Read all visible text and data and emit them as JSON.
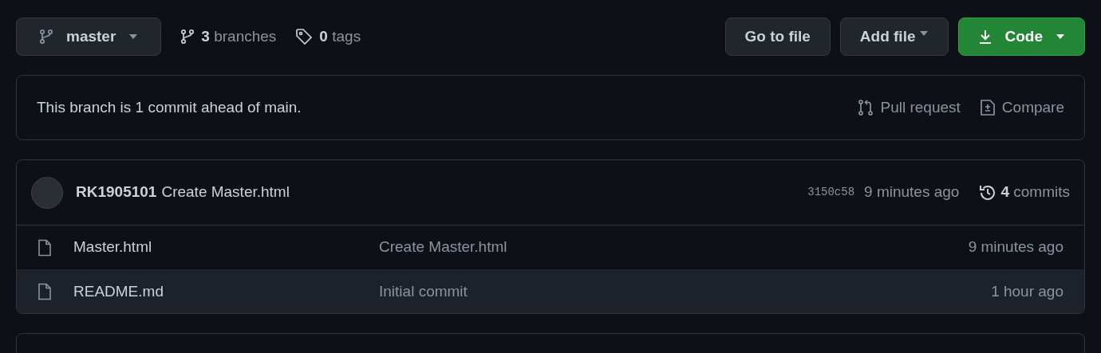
{
  "branch_button": {
    "label": "master"
  },
  "branches": {
    "count": "3",
    "label": "branches"
  },
  "tags": {
    "count": "0",
    "label": "tags"
  },
  "buttons": [
    {
      "label": "Go to file",
      "kind": "plain"
    },
    {
      "label": "Add file",
      "kind": "dropdown"
    },
    {
      "label": "Code",
      "kind": "primary"
    }
  ],
  "banner": {
    "text": "This branch is 1 commit ahead of main.",
    "actions": [
      {
        "label": "Pull request",
        "kind": "pull"
      },
      {
        "label": "Compare",
        "kind": "compare"
      }
    ]
  },
  "latest_commit": {
    "author": "RK1905101",
    "message": "Create Master.html",
    "sha": "3150c58",
    "time": "9 minutes ago",
    "commit_count": "4",
    "commit_label": "commits"
  },
  "files": [
    {
      "name": "Master.html",
      "message": "Create Master.html",
      "time": "9 minutes ago",
      "selected": false
    },
    {
      "name": "README.md",
      "message": "Initial commit",
      "time": "1 hour ago",
      "selected": true
    }
  ]
}
